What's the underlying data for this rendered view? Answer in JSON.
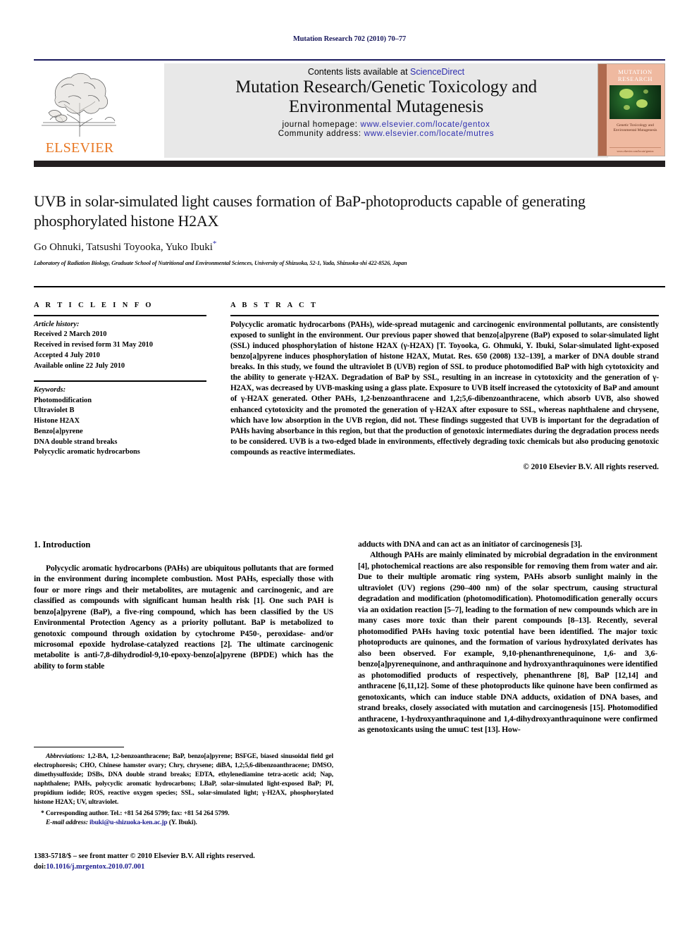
{
  "running_head": "Mutation Research 702 (2010) 70–77",
  "header": {
    "contents_prefix": "Contents lists available at ",
    "sciencedirect": "ScienceDirect",
    "journal_title_line1": "Mutation Research/Genetic Toxicology and",
    "journal_title_line2": "Environmental Mutagenesis",
    "homepage_label": "journal homepage:",
    "homepage_url": "www.elsevier.com/locate/gentox",
    "community_label": "Community address:",
    "community_url": "www.elsevier.com/locate/mutres",
    "publisher_name": "ELSEVIER",
    "publisher_accent": "#E87722",
    "link_color": "#2c2cae",
    "running_head_color": "#1a1a5e"
  },
  "cover": {
    "title_line1": "MUTATION",
    "title_line2": "RESEARCH",
    "subtitle_line1": "Genetic Toxicology and",
    "subtitle_line2": "Environmental Mutagenesis",
    "footer_text": "www.elsevier.com/locate/gentox",
    "background": "#efb9a0"
  },
  "article": {
    "title": "UVB in solar-simulated light causes formation of BaP-photoproducts capable of generating phosphorylated histone H2AX",
    "authors": "Go Ohnuki, Tatsushi Toyooka, Yuko Ibuki",
    "corresponding_marker": "*",
    "affiliation": "Laboratory of Radiation Biology, Graduate School of Nutritional and Environmental Sciences, University of Shizuoka, 52-1, Yada, Shizuoka-shi 422-8526, Japan"
  },
  "article_info": {
    "heading": "A R T I C L E   I N F O",
    "history_label": "Article history:",
    "history": [
      "Received 2 March 2010",
      "Received in revised form 31 May 2010",
      "Accepted 4 July 2010",
      "Available online 22 July 2010"
    ],
    "keywords_label": "Keywords:",
    "keywords": [
      "Photomodification",
      "Ultraviolet B",
      "Histone H2AX",
      "Benzo[a]pyrene",
      "DNA double strand breaks",
      "Polycyclic aromatic hydrocarbons"
    ]
  },
  "abstract": {
    "heading": "A B S T R A C T",
    "text": "Polycyclic aromatic hydrocarbons (PAHs), wide-spread mutagenic and carcinogenic environmental pollutants, are consistently exposed to sunlight in the environment. Our previous paper showed that benzo[a]pyrene (BaP) exposed to solar-simulated light (SSL) induced phosphorylation of histone H2AX (γ-H2AX) [T. Toyooka, G. Ohmuki, Y. Ibuki, Solar-simulated light-exposed benzo[a]pyrene induces phosphorylation of histone H2AX, Mutat. Res. 650 (2008) 132–139], a marker of DNA double strand breaks. In this study, we found the ultraviolet B (UVB) region of SSL to produce photomodified BaP with high cytotoxicity and the ability to generate γ-H2AX. Degradation of BaP by SSL, resulting in an increase in cytotoxicity and the generation of γ-H2AX, was decreased by UVB-masking using a glass plate. Exposure to UVB itself increased the cytotoxicity of BaP and amount of γ-H2AX generated. Other PAHs, 1,2-benzoanthracene and 1,2;5,6-dibenzoanthracene, which absorb UVB, also showed enhanced cytotoxicity and the promoted the generation of γ-H2AX after exposure to SSL, whereas naphthalene and chrysene, which have low absorption in the UVB region, did not. These findings suggested that UVB is important for the degradation of PAHs having absorbance in this region, but that the production of genotoxic intermediates during the degradation process needs to be considered. UVB is a two-edged blade in environments, effectively degrading toxic chemicals but also producing genotoxic compounds as reactive intermediates.",
    "copyright": "© 2010 Elsevier B.V. All rights reserved."
  },
  "body": {
    "section_heading": "1.  Introduction",
    "left_paragraph": "Polycyclic aromatic hydrocarbons (PAHs) are ubiquitous pollutants that are formed in the environment during incomplete combustion. Most PAHs, especially those with four or more rings and their metabolites, are mutagenic and carcinogenic, and are classified as compounds with significant human health risk [1]. One such PAH is benzo[a]pyrene (BaP), a five-ring compound, which has been classified by the US Environmental Protection Agency as a priority pollutant. BaP is metabolized to genotoxic compound through oxidation by cytochrome P450-, peroxidase- and/or microsomal epoxide hydrolase-catalyzed reactions [2]. The ultimate carcinogenic metabolite is anti-7,8-dihydrodiol-9,10-epoxy-benzo[a]pyrene (BPDE) which has the ability to form stable",
    "right_paragraph_1": "adducts with DNA and can act as an initiator of carcinogenesis [3].",
    "right_paragraph_2": "Although PAHs are mainly eliminated by microbial degradation in the environment [4], photochemical reactions are also responsible for removing them from water and air. Due to their multiple aromatic ring system, PAHs absorb sunlight mainly in the ultraviolet (UV) regions (290–400 nm) of the solar spectrum, causing structural degradation and modification (photomodification). Photomodification generally occurs via an oxidation reaction [5–7], leading to the formation of new compounds which are in many cases more toxic than their parent compounds [8–13]. Recently, several photomodified PAHs having toxic potential have been identified. The major toxic photoproducts are quinones, and the formation of various hydroxylated derivates has also been observed. For example, 9,10-phenanthrenequinone, 1,6- and 3,6-benzo[a]pyrenequinone, and anthraquinone and hydroxyanthraquinones were identified as photomodified products of respectively, phenanthrene [8], BaP [12,14] and anthracene [6,11,12]. Some of these photoproducts like quinone have been confirmed as genotoxicants, which can induce stable DNA adducts, oxidation of DNA bases, and strand breaks, closely associated with mutation and carcinogenesis [15]. Photomodified anthracene, 1-hydroxyanthraquinone and 1,4-dihydroxyanthraquinone were confirmed as genotoxicants using the umuC test [13]. How-"
  },
  "footnotes": {
    "abbreviations_label": "Abbreviations:",
    "abbreviations_text": "1,2-BA, 1,2-benzoanthracene; BaP, benzo[a]pyrene; BSFGE, biased sinusoidal field gel electrophoresis; CHO, Chinese hamster ovary; Chry, chrysene; diBA, 1,2;5,6-dibenzoanthracene; DMSO, dimethysulfoxide; DSBs, DNA double strand breaks; EDTA, ethylenediamine tetra-acetic acid; Nap, naphthalene; PAHs, polycyclic aromatic hydrocarbons; LBaP, solar-simulated light-exposed BaP; PI, propidium iodide; ROS, reactive oxygen species; SSL, solar-simulated light; γ-H2AX, phosphorylated histone H2AX; UV, ultraviolet.",
    "corresponding": "* Corresponding author. Tel.: +81 54 264 5799; fax: +81 54 264 5799.",
    "email_label": "E-mail address:",
    "email": "ibuki@u-shizuoka-ken.ac.jp",
    "email_suffix": "(Y. Ibuki)."
  },
  "footer": {
    "issn_line": "1383-5718/$ – see front matter © 2010 Elsevier B.V. All rights reserved.",
    "doi_prefix": "doi:",
    "doi": "10.1016/j.mrgentox.2010.07.001"
  }
}
